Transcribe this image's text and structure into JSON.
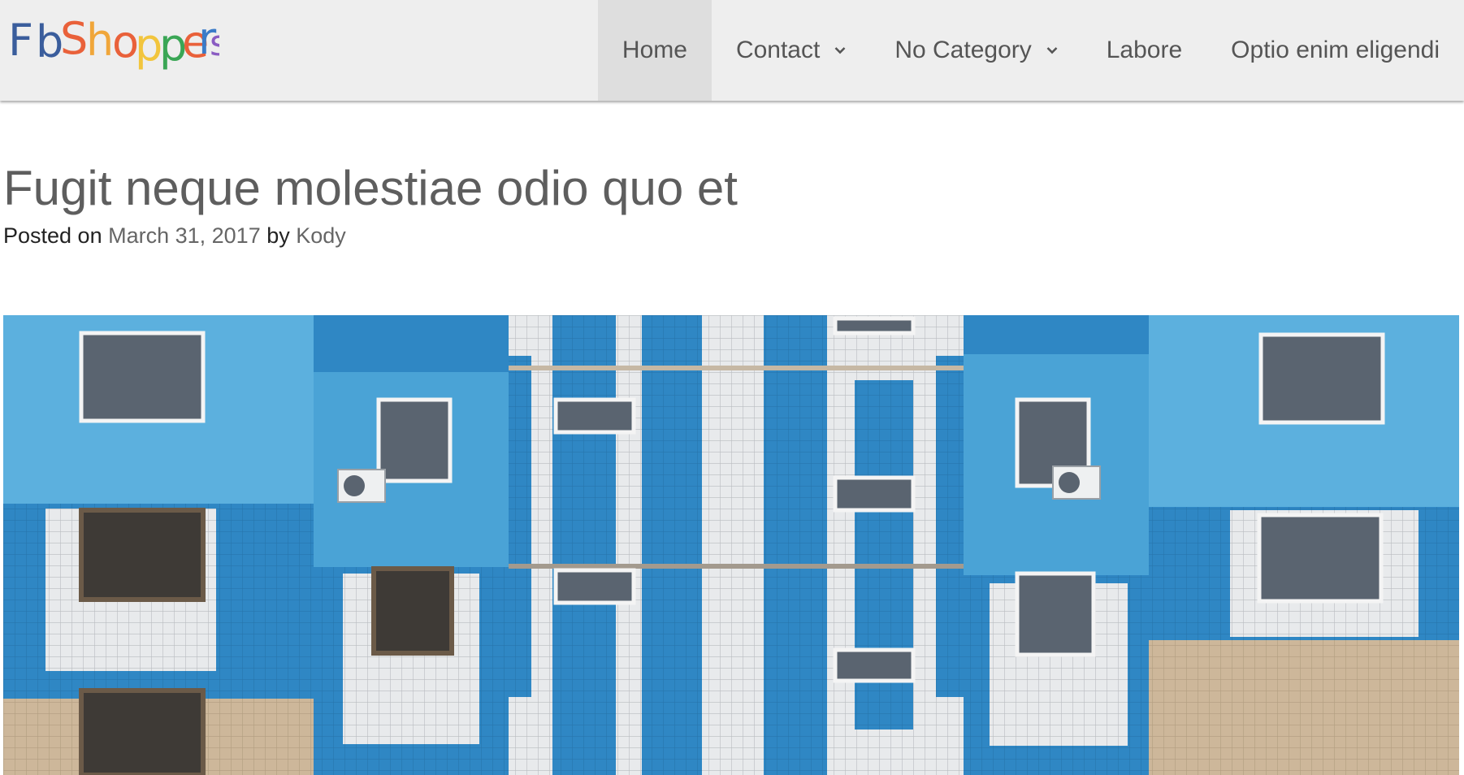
{
  "site": {
    "logo_text": "FbShoppers",
    "logo_letters": [
      {
        "ch": "F",
        "color": "#3a5d9c"
      },
      {
        "ch": "b",
        "color": "#3a5d9c"
      },
      {
        "ch": "S",
        "color": "#e9613a"
      },
      {
        "ch": "h",
        "color": "#f0a63a"
      },
      {
        "ch": "o",
        "color": "#e9613a"
      },
      {
        "ch": "p",
        "color": "#f2c53d"
      },
      {
        "ch": "p",
        "color": "#3aa655"
      },
      {
        "ch": "e",
        "color": "#e9613a"
      },
      {
        "ch": "r",
        "color": "#3a7bc8"
      },
      {
        "ch": "s",
        "color": "#8a5cc2"
      }
    ]
  },
  "nav": {
    "items": [
      {
        "label": "Home",
        "active": true,
        "has_dropdown": false
      },
      {
        "label": "Contact",
        "active": false,
        "has_dropdown": true
      },
      {
        "label": "No Category",
        "active": false,
        "has_dropdown": true
      },
      {
        "label": "Labore",
        "active": false,
        "has_dropdown": false
      },
      {
        "label": "Optio enim eligendi",
        "active": false,
        "has_dropdown": false
      }
    ]
  },
  "post": {
    "title": "Fugit neque molestiae odio quo et",
    "meta_prefix": "Posted on ",
    "date": "March 31, 2017",
    "meta_by": " by ",
    "author": "Kody"
  },
  "featured_image": {
    "subject": "blue tiled apartment building facade"
  },
  "colors": {
    "header_bg": "#eeeeee",
    "active_nav_bg": "#dedede",
    "tile_blue": "#2f87c4",
    "light_blue": "#5cb0de",
    "tile_white": "#e6e8ea",
    "beige": "#cdb79a"
  }
}
